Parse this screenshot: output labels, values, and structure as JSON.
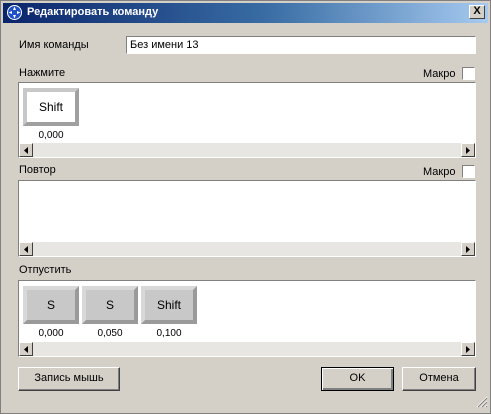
{
  "window": {
    "title": "Редактировать команду",
    "close_symbol": "X"
  },
  "command_name": {
    "label": "Имя команды",
    "value": "Без имени 13"
  },
  "press_section": {
    "label": "Нажмите",
    "macro_label": "Макро",
    "macro_checked": false,
    "keys": [
      {
        "label": "Shift",
        "time": "0,000"
      }
    ]
  },
  "repeat_section": {
    "label": "Повтор",
    "macro_label": "Макро",
    "macro_checked": false,
    "keys": []
  },
  "release_section": {
    "label": "Отпустить",
    "keys": [
      {
        "label": "S",
        "time": "0,000"
      },
      {
        "label": "S",
        "time": "0,050"
      },
      {
        "label": "Shift",
        "time": "0,100"
      }
    ]
  },
  "buttons": {
    "record_mouse": "Запись мышь",
    "ok": "OK",
    "cancel": "Отмена"
  },
  "icons": {
    "window": "crosshair-icon",
    "scroll_left": "arrow-left-icon",
    "scroll_right": "arrow-right-icon",
    "resize": "resize-grip-icon"
  }
}
